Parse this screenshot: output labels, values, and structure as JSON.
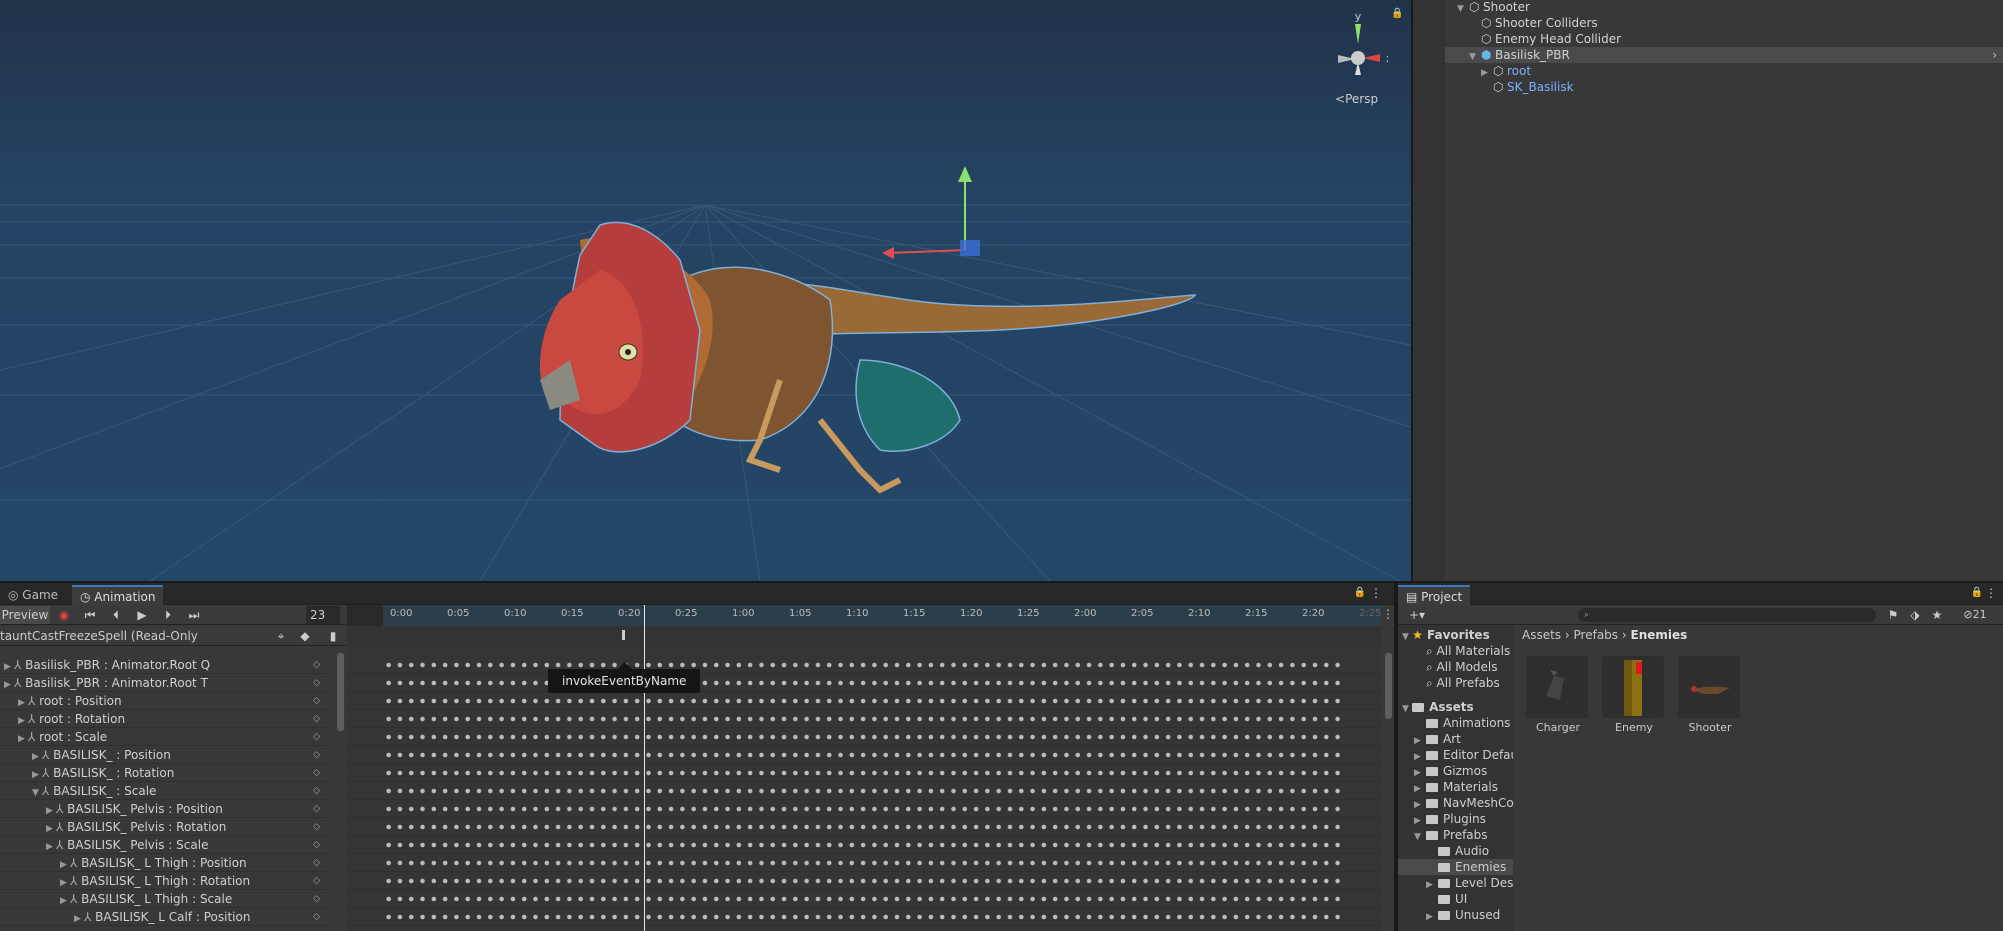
{
  "scene": {
    "persp_label": "Persp",
    "axis_y": "y",
    "axis_x": "x"
  },
  "hierarchy": {
    "items": [
      {
        "label": "Shooter"
      },
      {
        "label": "Shooter Colliders"
      },
      {
        "label": "Enemy Head Collider"
      },
      {
        "label": "Basilisk_PBR"
      },
      {
        "label": "root"
      },
      {
        "label": "SK_Basilisk"
      }
    ]
  },
  "animation": {
    "tabs": {
      "game": "Game",
      "animation": "Animation"
    },
    "preview_label": "Preview",
    "frame": "23",
    "clip_name": "tauntCastFreezeSpell (Read-Only)",
    "event_tooltip": "invokeEventByName",
    "ticks": [
      "0:00",
      "0:05",
      "0:10",
      "0:15",
      "0:20",
      "0:25",
      "1:00",
      "1:05",
      "1:10",
      "1:15",
      "1:20",
      "1:25",
      "2:00",
      "2:05",
      "2:10",
      "2:15",
      "2:20",
      "2:25"
    ],
    "tracks": [
      {
        "label": "Basilisk_PBR : Animator.Root Q"
      },
      {
        "label": "Basilisk_PBR : Animator.Root T"
      },
      {
        "label": "root : Position"
      },
      {
        "label": "root : Rotation"
      },
      {
        "label": "root : Scale"
      },
      {
        "label": "BASILISK_ : Position"
      },
      {
        "label": "BASILISK_ : Rotation"
      },
      {
        "label": "BASILISK_ : Scale"
      },
      {
        "label": "BASILISK_ Pelvis : Position"
      },
      {
        "label": "BASILISK_ Pelvis : Rotation"
      },
      {
        "label": "BASILISK_ Pelvis : Scale"
      },
      {
        "label": "BASILISK_ L Thigh : Position"
      },
      {
        "label": "BASILISK_ L Thigh : Rotation"
      },
      {
        "label": "BASILISK_ L Thigh : Scale"
      },
      {
        "label": "BASILISK_ L Calf : Position"
      }
    ]
  },
  "project": {
    "tab": "Project",
    "asset_count": "21",
    "favorites_label": "Favorites",
    "favorites": [
      {
        "label": "All Materials"
      },
      {
        "label": "All Models"
      },
      {
        "label": "All Prefabs"
      }
    ],
    "assets_label": "Assets",
    "folders": [
      {
        "label": "Animations"
      },
      {
        "label": "Art"
      },
      {
        "label": "Editor Default Resources"
      },
      {
        "label": "Gizmos"
      },
      {
        "label": "Materials"
      },
      {
        "label": "NavMeshComponents"
      },
      {
        "label": "Plugins"
      },
      {
        "label": "Prefabs"
      },
      {
        "label": "Audio"
      },
      {
        "label": "Enemies"
      },
      {
        "label": "Level Design"
      },
      {
        "label": "UI"
      },
      {
        "label": "Unused"
      }
    ],
    "breadcrumb": {
      "a": "Assets",
      "b": "Prefabs",
      "c": "Enemies"
    },
    "grid": [
      {
        "label": "Charger"
      },
      {
        "label": "Enemy"
      },
      {
        "label": "Shooter"
      }
    ]
  }
}
